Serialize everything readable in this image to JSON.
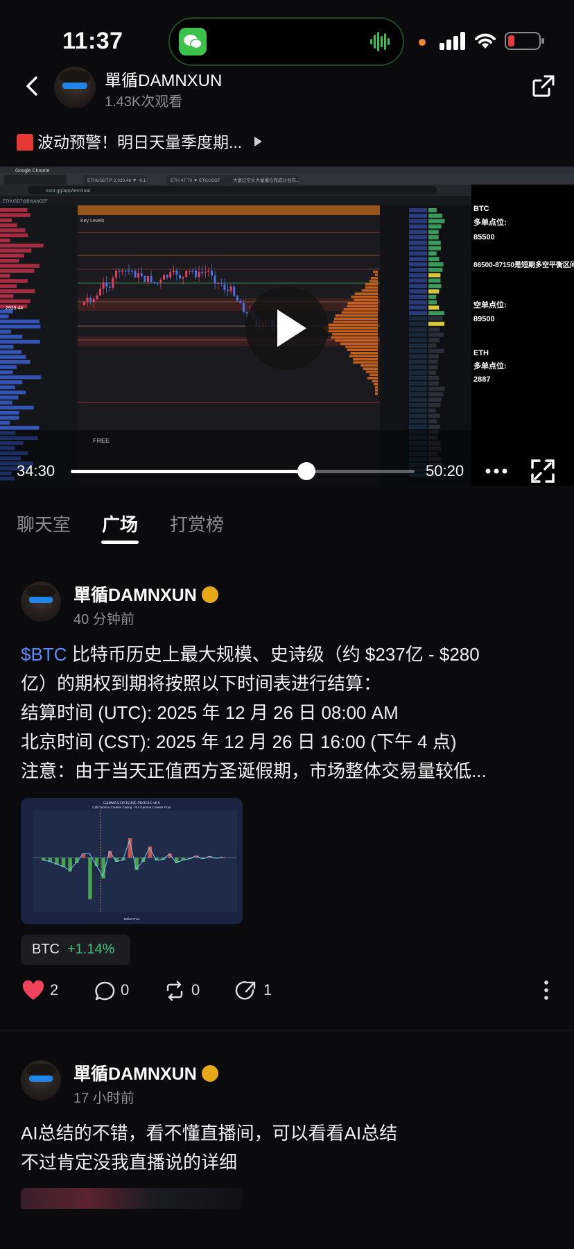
{
  "status_bar": {
    "time": "11:37"
  },
  "header": {
    "author_name": "單循DAMNXUN",
    "views": "1.43K次观看",
    "alert_title": "波动预警！明日天量季度期..."
  },
  "video": {
    "current_time": "34:30",
    "total_time": "50:20",
    "progress_fraction": 0.685,
    "browser_title": "Google Chrome",
    "address": "mmt.gg/app/terminal",
    "tabs": [
      "ETHUSDT.P 2,928.46 ▼ -0.1",
      "ETH 47.70 ▼ ETCUSDT",
      "大富亿空头大量爆仓完成计划布..."
    ],
    "chart_pair": "ETHUSDT@BINANCEF",
    "key_levels_label": "Key Levels",
    "free_label": "FREE",
    "price_marker": "2929.44",
    "notes": {
      "btc_title": "BTC",
      "btc_long_label": "多单点位:",
      "btc_long_value": "85500",
      "btc_range": "86500-87150是短期多空平衡区间",
      "btc_short_label": "空单点位:",
      "btc_short_value": "89500",
      "eth_title": "ETH",
      "eth_long_label": "多单点位:",
      "eth_long_value": "2887"
    }
  },
  "tabs": [
    {
      "label": "聊天室",
      "active": false
    },
    {
      "label": "广场",
      "active": true
    },
    {
      "label": "打赏榜",
      "active": false
    }
  ],
  "posts": [
    {
      "author": "單循DAMNXUN",
      "time": "40 分钟前",
      "ticker": "$BTC",
      "lines": [
        "比特币历史上最大规模、史诗级（约 $237亿 - $280",
        "亿）的期权到期将按照以下时间表进行结算：",
        "结算时间 (UTC): 2025 年 12 月 26 日 08:00 AM",
        "北京时间 (CST): 2025 年 12 月 26 日 16:00 (下午 4 点)",
        "注意：由于当天正值西方圣诞假期，市场整体交易量较低..."
      ],
      "image_title": "GAMMA EXPOSURE PROFILE v6.5",
      "image_subtitle": "Call Gamma Creates Ceiling · Put Gamma Creates Floor",
      "image_xlabel": "Strike Price",
      "coin": {
        "name": "BTC",
        "change": "+1.14%"
      },
      "actions": {
        "likes": "2",
        "comments": "0",
        "reposts": "0",
        "shares": "1"
      }
    },
    {
      "author": "單循DAMNXUN",
      "time": "17 小时前",
      "lines": [
        "AI总结的不错，看不懂直播间，可以看看AI总结",
        "不过肯定没我直播说的详细"
      ]
    }
  ],
  "colors": {
    "accent_blue": "#5b8cff",
    "positive_green": "#3fc27d",
    "like_red": "#f0445a",
    "verified_gold": "#e6a817"
  }
}
